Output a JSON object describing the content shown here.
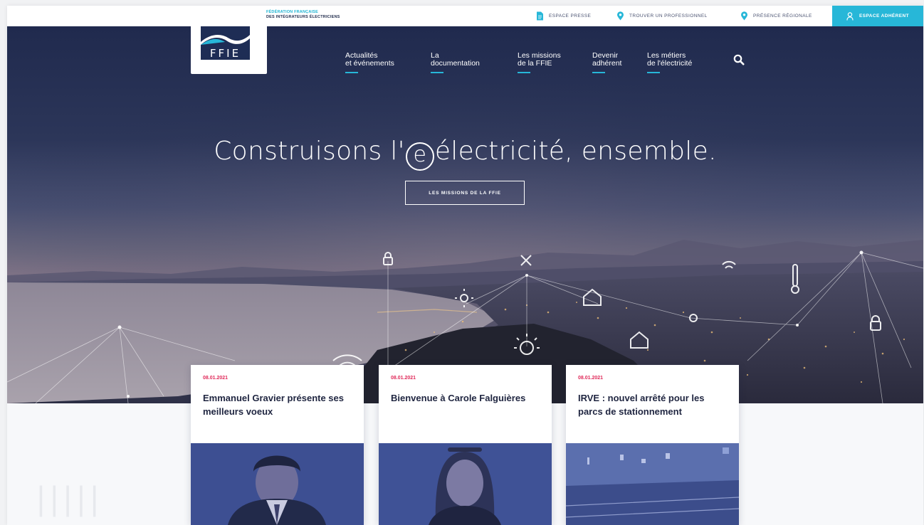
{
  "header": {
    "federation_line1": "FÉDÉRATION FRANÇAISE",
    "federation_line2": "DES INTÉGRATEURS ÉLECTRICIENS",
    "logo_text": "FFIE",
    "utility_links": [
      {
        "label": "ESPACE PRESSE",
        "icon": "document-icon"
      },
      {
        "label": "TROUVER UN PROFESSIONNEL",
        "icon": "location-pin-icon"
      },
      {
        "label": "PRÉSENCE RÉGIONALE",
        "icon": "location-pin-icon"
      }
    ],
    "member_button": {
      "label": "ESPACE ADHÉRENT",
      "icon": "user-icon"
    }
  },
  "nav": {
    "items": [
      {
        "line1": "Actualités",
        "line2": "et événements"
      },
      {
        "line1": "La",
        "line2": "documentation"
      },
      {
        "line1": "Les missions",
        "line2": "de la FFIE"
      },
      {
        "line1": "Devenir",
        "line2": "adhérent"
      },
      {
        "line1": "Les métiers",
        "line2": "de l'électricité"
      }
    ],
    "search_icon": "search-icon"
  },
  "hero": {
    "headline_before": "Construisons l'",
    "headline_circle": "e",
    "headline_after": "électricité, ensemble.",
    "cta_label": "LES MISSIONS DE LA FFIE"
  },
  "cards": [
    {
      "date": "08.01.2021",
      "title": "Emmanuel Gravier présente ses meilleurs voeux"
    },
    {
      "date": "08.01.2021",
      "title": "Bienvenue à Carole Falguières"
    },
    {
      "date": "08.01.2021",
      "title": "IRVE : nouvel arrêté pour les parcs de stationnement"
    }
  ],
  "colors": {
    "accent": "#27b7d8",
    "navy": "#1e2d55",
    "date_pink": "#e02a5a"
  }
}
